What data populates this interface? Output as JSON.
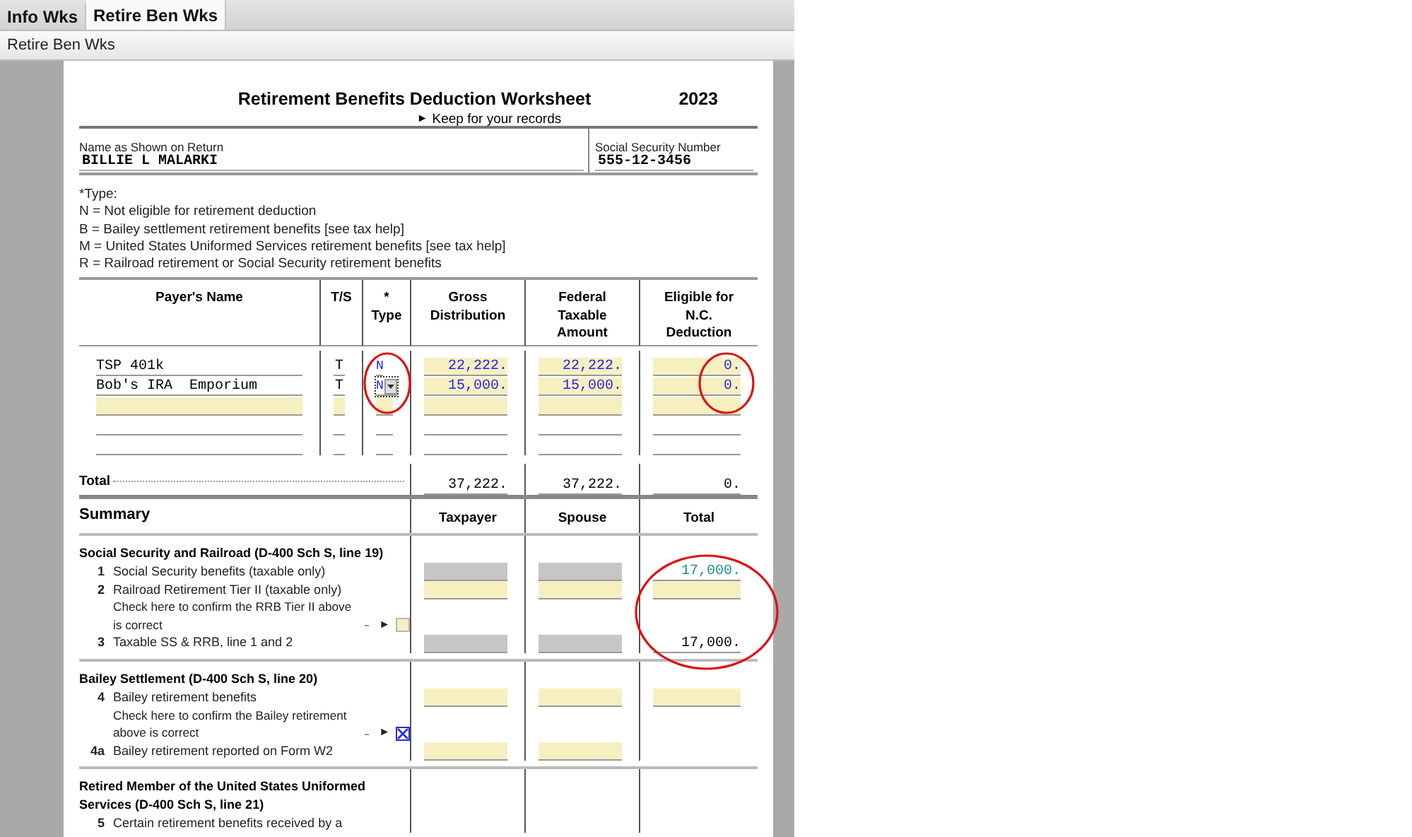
{
  "tabs": [
    {
      "label": "Info Wks",
      "selected": false
    },
    {
      "label": "Retire Ben Wks",
      "selected": true
    }
  ],
  "breadcrumb": "Retire Ben Wks",
  "form": {
    "title": "Retirement Benefits Deduction Worksheet",
    "year": "2023",
    "subtitle_arrow": "►",
    "subtitle": "Keep for your records",
    "name_label": "Name as Shown on Return",
    "name": "BILLIE L MALARKI",
    "ssn_label": "Social Security Number",
    "ssn": "555-12-3456",
    "type_legend": [
      "*Type:",
      "N = Not eligible for retirement deduction",
      "B = Bailey settlement retirement benefits [see tax help]",
      "M = United States Uniformed Services retirement benefits [see tax help]",
      "R = Railroad retirement or Social Security retirement benefits"
    ],
    "columns": [
      [
        "Payer's Name"
      ],
      [
        "T/S"
      ],
      [
        "*",
        "Type"
      ],
      [
        "Gross",
        "Distribution"
      ],
      [
        "Federal",
        "Taxable",
        "Amount"
      ],
      [
        "Eligible for",
        "N.C.",
        "Deduction"
      ]
    ],
    "rows": [
      {
        "payer": "TSP 401k",
        "ts": "T",
        "type": "N",
        "type_focused": false,
        "gross": "22,222.",
        "federal": "22,222.",
        "eligible": "0."
      },
      {
        "payer": "Bob's IRA  Emporium",
        "ts": "T",
        "type": "N",
        "type_focused": true,
        "gross": "15,000.",
        "federal": "15,000.",
        "eligible": "0."
      }
    ],
    "total": {
      "label": "Total",
      "values": [
        "37,222.",
        "37,222.",
        "0."
      ]
    },
    "summary": {
      "title": "Summary",
      "columns": [
        "Taxpayer",
        "Spouse",
        "Total"
      ],
      "sections": [
        {
          "title": "Social Security and Railroad  (D-400 Sch S, line 19)",
          "lines": [
            {
              "kind": "line",
              "num": "1",
              "text": "Social Security benefits (taxable only)",
              "cells": [
                {
                  "kind": "shaded"
                },
                {
                  "kind": "shaded"
                },
                {
                  "kind": "linked",
                  "value": "17,000."
                }
              ]
            },
            {
              "kind": "line",
              "num": "2",
              "text": "Railroad Retirement Tier II  (taxable only)",
              "cells": [
                {
                  "kind": "input"
                },
                {
                  "kind": "input"
                },
                {
                  "kind": "input"
                }
              ]
            },
            {
              "kind": "check",
              "text": "Check here to confirm the RRB Tier II above is correct",
              "arrow": "►",
              "checked": false
            },
            {
              "kind": "line",
              "num": "3",
              "text": "Taxable SS & RRB, line 1 and 2",
              "cells": [
                {
                  "kind": "shaded"
                },
                {
                  "kind": "shaded"
                },
                {
                  "kind": "calc",
                  "value": "17,000."
                }
              ]
            }
          ]
        },
        {
          "title": "Bailey Settlement (D-400 Sch S, line 20)",
          "lines": [
            {
              "kind": "line",
              "num": "4",
              "text": "Bailey retirement benefits",
              "cells": [
                {
                  "kind": "input"
                },
                {
                  "kind": "input"
                },
                {
                  "kind": "input"
                }
              ]
            },
            {
              "kind": "check",
              "text": "Check here to confirm the Bailey retirement above is correct",
              "arrow": "►",
              "checked": true
            },
            {
              "kind": "line",
              "num": "4a",
              "text": "Bailey retirement reported on Form W2",
              "cells": [
                {
                  "kind": "input"
                },
                {
                  "kind": "input"
                },
                {
                  "kind": "none"
                }
              ]
            }
          ]
        },
        {
          "title": "Retired Member of the United States Uniformed Services (D-400 Sch S, line 21)",
          "lines": [
            {
              "kind": "line",
              "num": "5",
              "text": "Certain retirement benefits received by a",
              "cells": [
                {
                  "kind": "none"
                },
                {
                  "kind": "none"
                },
                {
                  "kind": "none"
                }
              ]
            }
          ]
        }
      ]
    }
  }
}
